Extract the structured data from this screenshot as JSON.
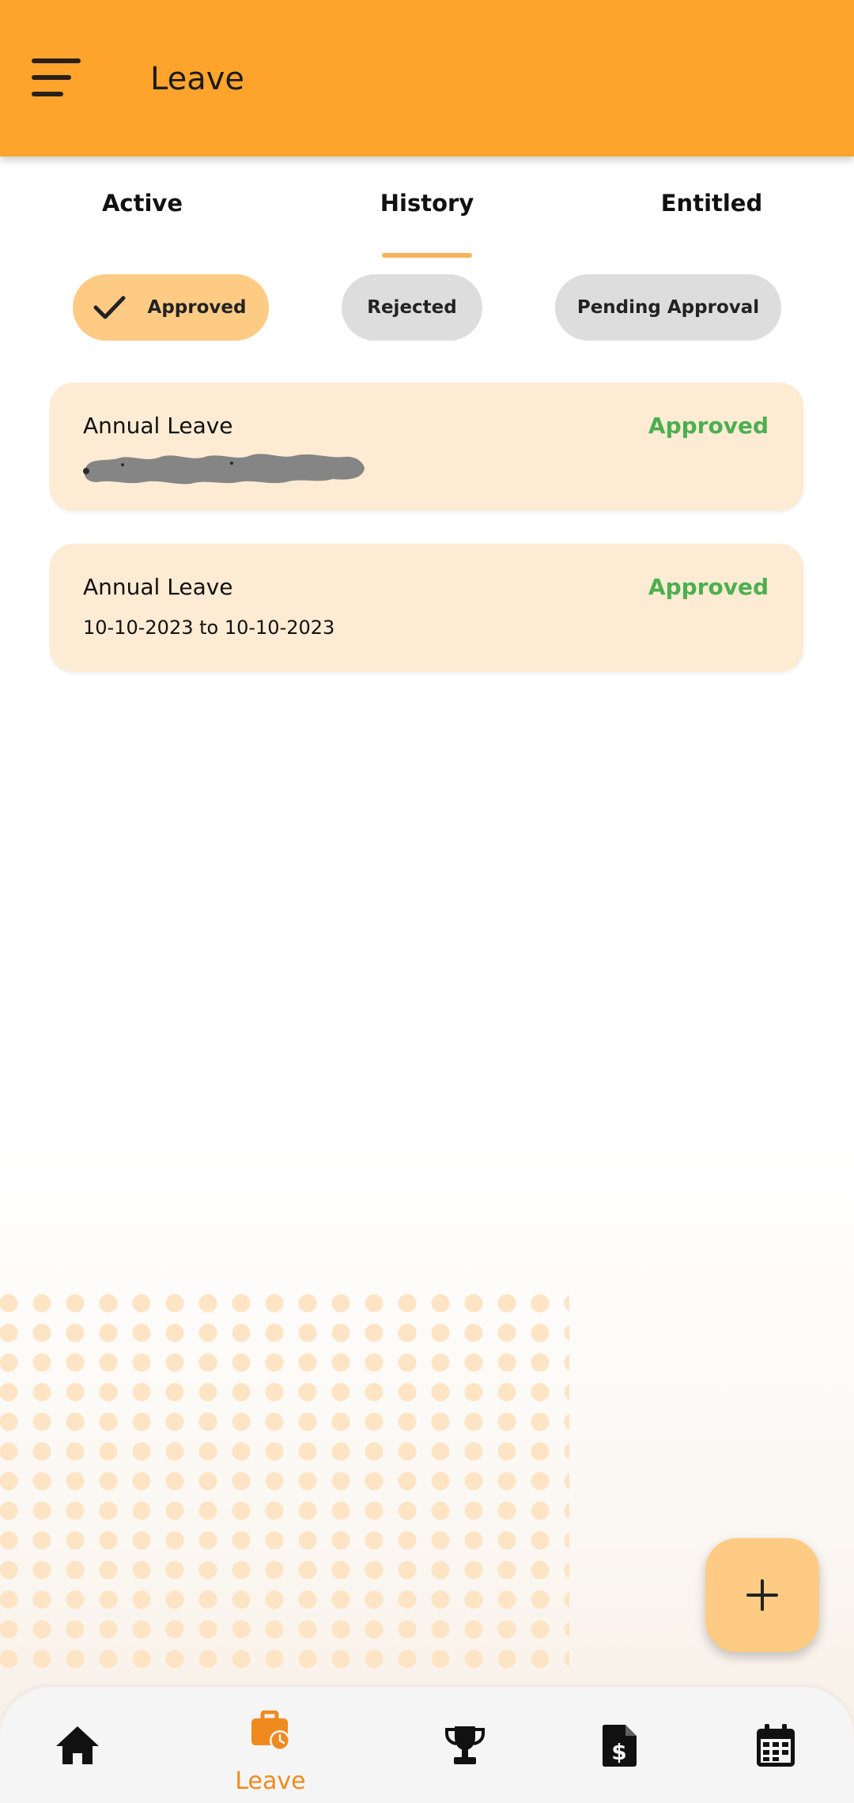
{
  "app_bar": {
    "title": "Leave",
    "menu_icon": "hamburger-menu-icon"
  },
  "tabs": [
    {
      "label": "Active",
      "selected": false
    },
    {
      "label": "History",
      "selected": true
    },
    {
      "label": "Entitled",
      "selected": false
    }
  ],
  "filters": [
    {
      "label": "Approved",
      "selected": true,
      "icon": "check-icon"
    },
    {
      "label": "Rejected",
      "selected": false
    },
    {
      "label": "Pending Approval",
      "selected": false
    }
  ],
  "leave_items": [
    {
      "type": "Annual Leave",
      "status": "Approved",
      "dates": "",
      "dates_redacted": true
    },
    {
      "type": "Annual Leave",
      "status": "Approved",
      "dates": "10-10-2023 to 10-10-2023",
      "dates_redacted": false
    }
  ],
  "fab": {
    "icon": "plus-icon"
  },
  "bottom_nav": [
    {
      "icon": "home-icon",
      "label": "",
      "active": false
    },
    {
      "icon": "briefcase-clock-icon",
      "label": "Leave",
      "active": true
    },
    {
      "icon": "trophy-icon",
      "label": "",
      "active": false
    },
    {
      "icon": "dollar-document-icon",
      "label": "",
      "active": false
    },
    {
      "icon": "calendar-icon",
      "label": "",
      "active": false
    }
  ],
  "colors": {
    "primary": "#fea42c",
    "chip_selected": "#fdcb84",
    "chip_unselected": "#dddddd",
    "card_background": "#fdebd3",
    "status_approved": "#4caf50",
    "nav_active": "#ef8a1f",
    "tab_indicator": "#f6b35a"
  }
}
